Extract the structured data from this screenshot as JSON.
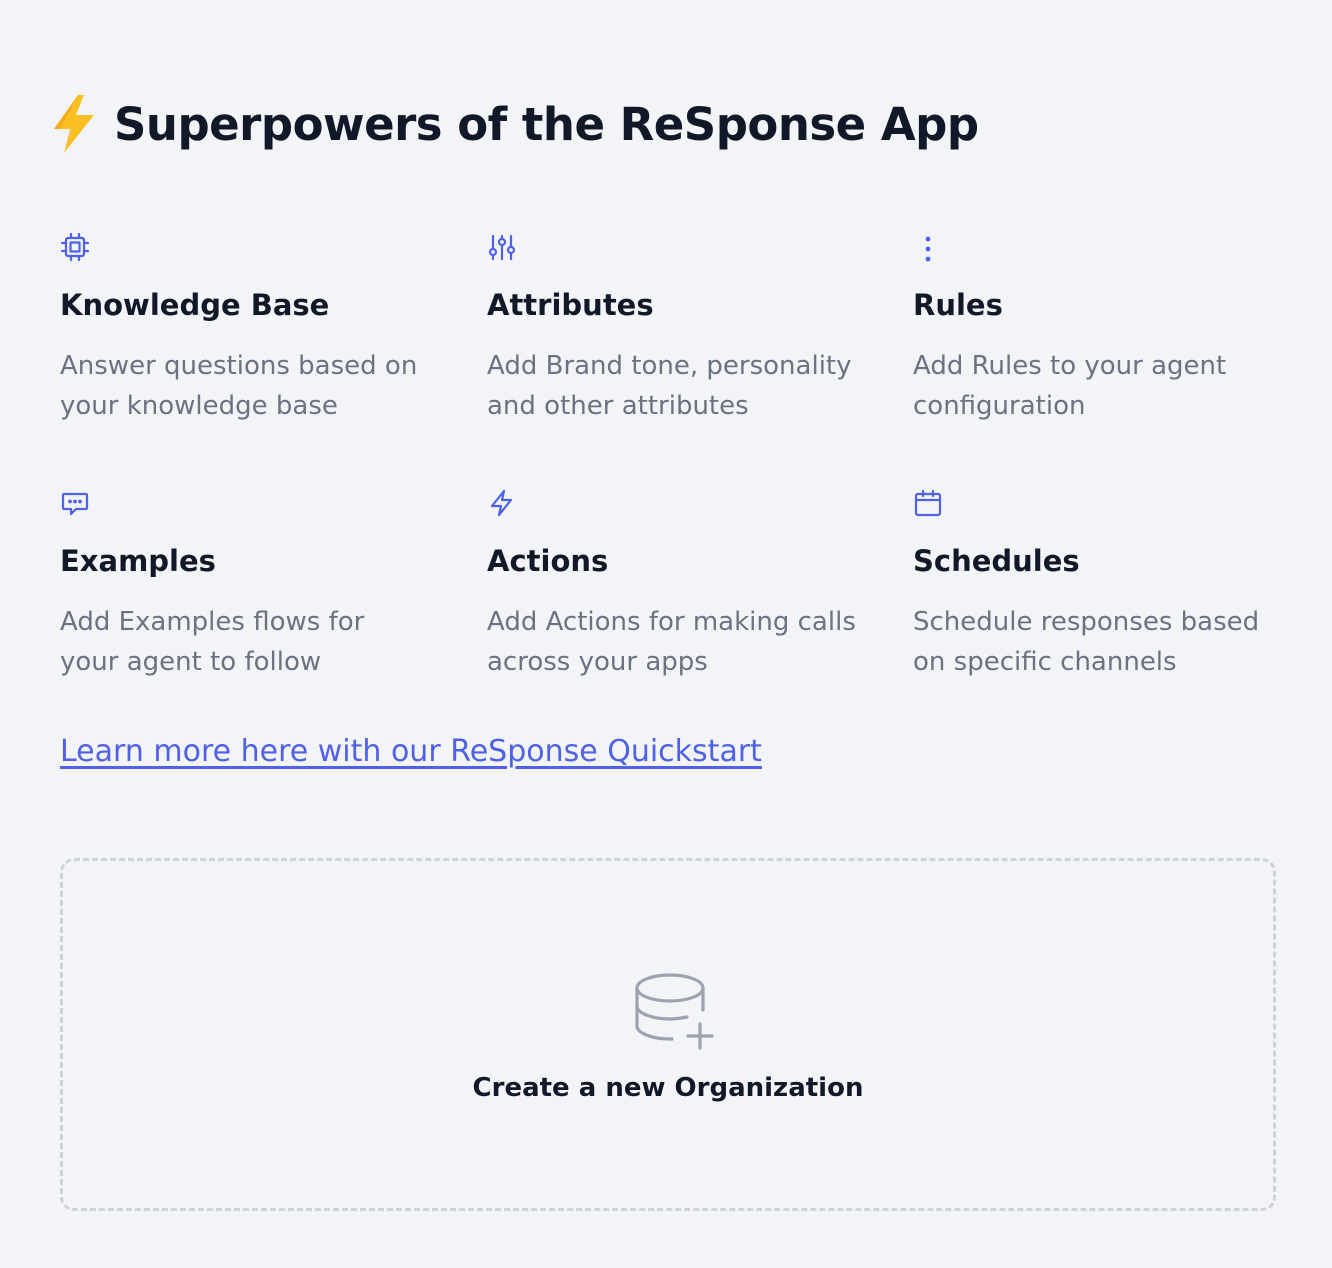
{
  "hero": {
    "icon": "lightning-bolt-emoji",
    "title": "Superpowers of the ReSponse App"
  },
  "features": [
    {
      "icon": "chip-icon",
      "title": "Knowledge Base",
      "description": "Answer questions based on your knowledge base"
    },
    {
      "icon": "sliders-icon",
      "title": "Attributes",
      "description": "Add Brand tone, personality and other attributes"
    },
    {
      "icon": "dots-vertical-icon",
      "title": "Rules",
      "description": "Add Rules to your agent configuration"
    },
    {
      "icon": "chat-bubble-icon",
      "title": "Examples",
      "description": "Add Examples flows for your agent to follow"
    },
    {
      "icon": "bolt-icon",
      "title": "Actions",
      "description": "Add Actions for making calls across your apps"
    },
    {
      "icon": "calendar-icon",
      "title": "Schedules",
      "description": "Schedule responses based on specific channels"
    }
  ],
  "learn_more": {
    "label": "Learn more here with our ReSponse Quickstart"
  },
  "create_org": {
    "icon": "database-plus-icon",
    "label": "Create a new Organization"
  },
  "colors": {
    "background": "#f3f4f8",
    "accent": "#4f61e6",
    "heading": "#111827",
    "muted": "#6b7280",
    "dashed_border": "#cfd2d8",
    "bolt_yellow": "#fbbf24"
  }
}
